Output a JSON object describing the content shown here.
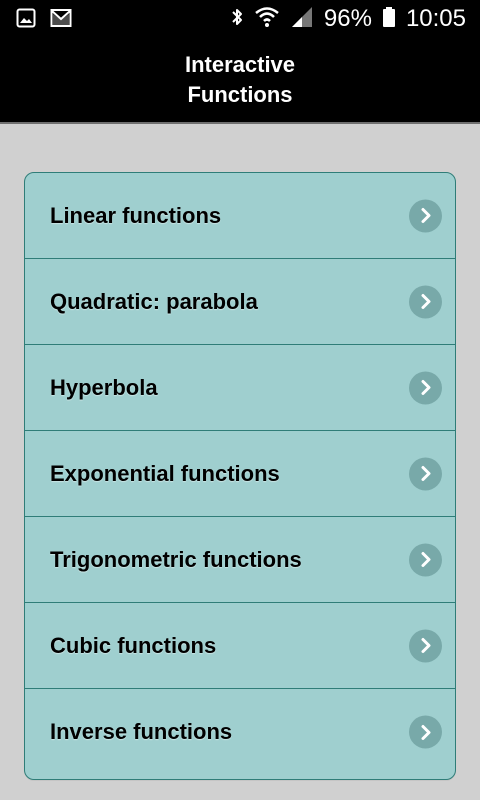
{
  "status_bar": {
    "battery_percent": "96%",
    "time": "10:05",
    "icons": [
      "gallery-icon",
      "gmail-icon",
      "bluetooth-icon",
      "wifi-icon",
      "signal-icon",
      "battery-icon"
    ]
  },
  "header": {
    "title_line1": "Interactive",
    "title_line2": "Functions"
  },
  "menu": {
    "items": [
      {
        "label": "Linear functions"
      },
      {
        "label": "Quadratic: parabola"
      },
      {
        "label": "Hyperbola"
      },
      {
        "label": "Exponential functions"
      },
      {
        "label": "Trigonometric functions"
      },
      {
        "label": "Cubic functions"
      },
      {
        "label": "Inverse functions"
      }
    ]
  },
  "colors": {
    "header_bg": "#000000",
    "screen_bg": "#d0d0d0",
    "menu_bg": "#9fcfcf",
    "menu_border": "#2f7d78",
    "chevron_bg": "#78a9a9"
  }
}
